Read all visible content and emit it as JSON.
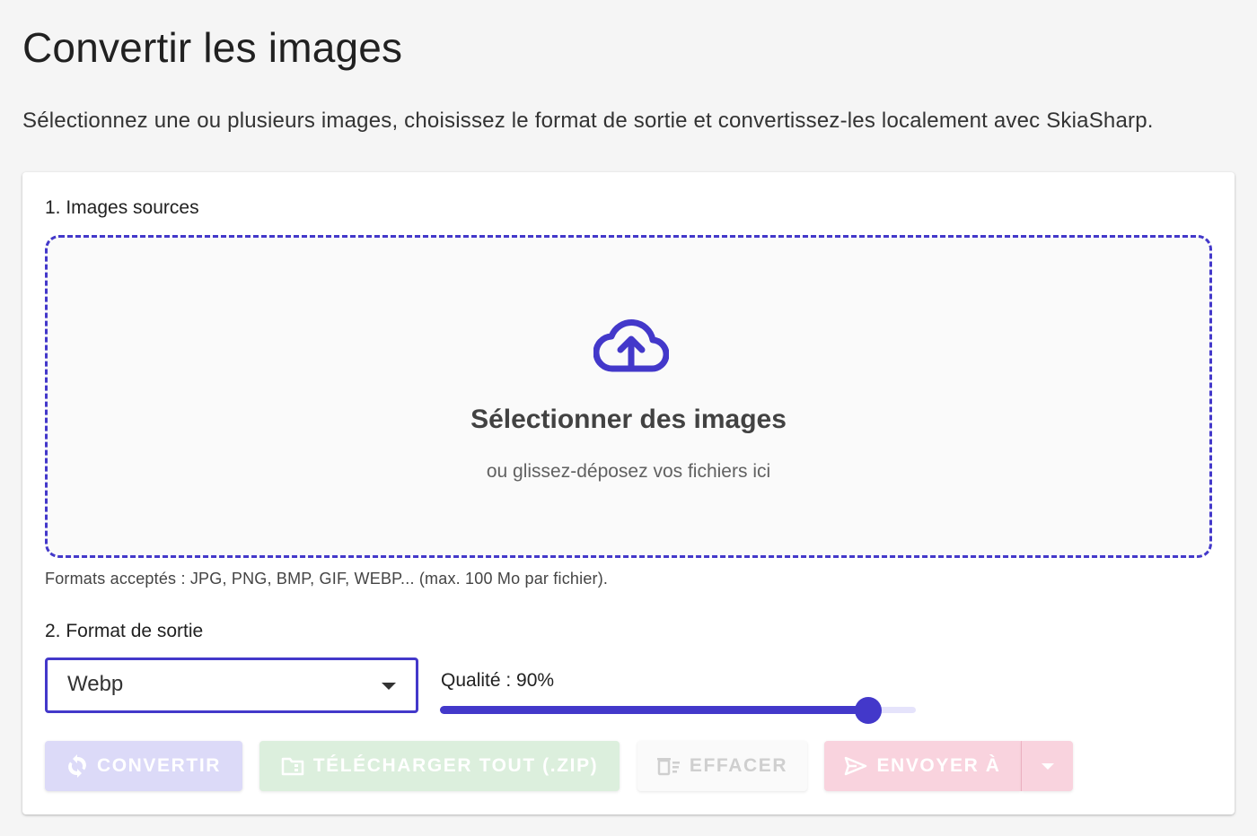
{
  "header": {
    "title": "Convertir les images",
    "subtitle": "Sélectionnez une ou plusieurs images, choisissez le format de sortie et convertissez-les localement avec SkiaSharp."
  },
  "sources": {
    "label": "1. Images sources",
    "dropzone_title": "Sélectionner des images",
    "dropzone_hint": "ou glissez-déposez vos fichiers ici",
    "dropzone_icon": "cloud-upload-icon",
    "formats_note": "Formats acceptés : JPG, PNG, BMP, GIF, WEBP... (max. 100 Mo par fichier)."
  },
  "output": {
    "label": "2. Format de sortie",
    "format_selected": "Webp",
    "quality_label": "Qualité : 90%",
    "quality_value": 90
  },
  "actions": {
    "convert_label": "CONVERTIR",
    "convert_icon": "sync-icon",
    "download_label": "TÉLÉCHARGER TOUT (.ZIP)",
    "download_icon": "folder-zip-icon",
    "clear_label": "EFFACER",
    "clear_icon": "delete-sweep-icon",
    "send_label": "ENVOYER À",
    "send_icon": "send-icon",
    "more_icon": "caret-down-icon"
  },
  "colors": {
    "primary": "#4338ca",
    "convert_disabled_bg": "#dcdaf8",
    "download_disabled_bg": "#dcefdd",
    "send_disabled_bg": "#f9d3de"
  }
}
